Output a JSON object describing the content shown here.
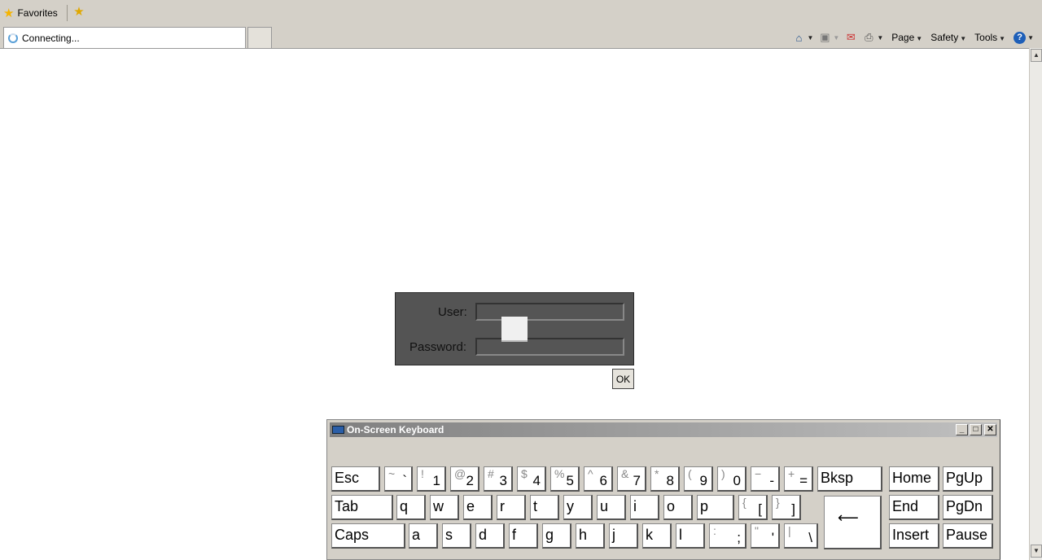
{
  "favorites_bar": {
    "favorites_label": "Favorites"
  },
  "tab": {
    "status": "Connecting..."
  },
  "command_bar": {
    "page": "Page",
    "safety": "Safety",
    "tools": "Tools",
    "help": "?"
  },
  "login": {
    "user_label": "User:",
    "password_label": "Password:",
    "user_value": "",
    "ok_label": "OK"
  },
  "osk": {
    "title": "On-Screen Keyboard",
    "row1": [
      {
        "main": "Esc",
        "shift": ""
      },
      {
        "main": "`",
        "shift": "~"
      },
      {
        "main": "1",
        "shift": "!"
      },
      {
        "main": "2",
        "shift": "@"
      },
      {
        "main": "3",
        "shift": "#"
      },
      {
        "main": "4",
        "shift": "$"
      },
      {
        "main": "5",
        "shift": "%"
      },
      {
        "main": "6",
        "shift": "^"
      },
      {
        "main": "7",
        "shift": "&"
      },
      {
        "main": "8",
        "shift": "*"
      },
      {
        "main": "9",
        "shift": "("
      },
      {
        "main": "0",
        "shift": ")"
      },
      {
        "main": "-",
        "shift": "−"
      },
      {
        "main": "=",
        "shift": "+"
      },
      {
        "main": "Bksp",
        "shift": ""
      },
      {
        "main": "Home",
        "shift": ""
      },
      {
        "main": "PgUp",
        "shift": ""
      }
    ],
    "row2": [
      {
        "main": "Tab",
        "shift": ""
      },
      {
        "main": "q"
      },
      {
        "main": "w"
      },
      {
        "main": "e"
      },
      {
        "main": "r"
      },
      {
        "main": "t"
      },
      {
        "main": "y"
      },
      {
        "main": "u"
      },
      {
        "main": "i"
      },
      {
        "main": "o"
      },
      {
        "main": "p"
      },
      {
        "main": "[",
        "shift": "{"
      },
      {
        "main": "]",
        "shift": "}"
      },
      {
        "main": "End",
        "shift": ""
      },
      {
        "main": "PgDn",
        "shift": ""
      }
    ],
    "row3": [
      {
        "main": "Caps",
        "shift": ""
      },
      {
        "main": "a"
      },
      {
        "main": "s"
      },
      {
        "main": "d"
      },
      {
        "main": "f"
      },
      {
        "main": "g"
      },
      {
        "main": "h"
      },
      {
        "main": "j"
      },
      {
        "main": "k"
      },
      {
        "main": "l"
      },
      {
        "main": ";",
        "shift": ":"
      },
      {
        "main": "'",
        "shift": "\""
      },
      {
        "main": "\\",
        "shift": "|"
      },
      {
        "main": "Insert",
        "shift": ""
      },
      {
        "main": "Pause",
        "shift": ""
      }
    ],
    "enter_symbol": "⟵"
  },
  "colors": {
    "chrome": "#d4d0c8",
    "login_bg": "#545454",
    "osk_title": "#808080"
  }
}
